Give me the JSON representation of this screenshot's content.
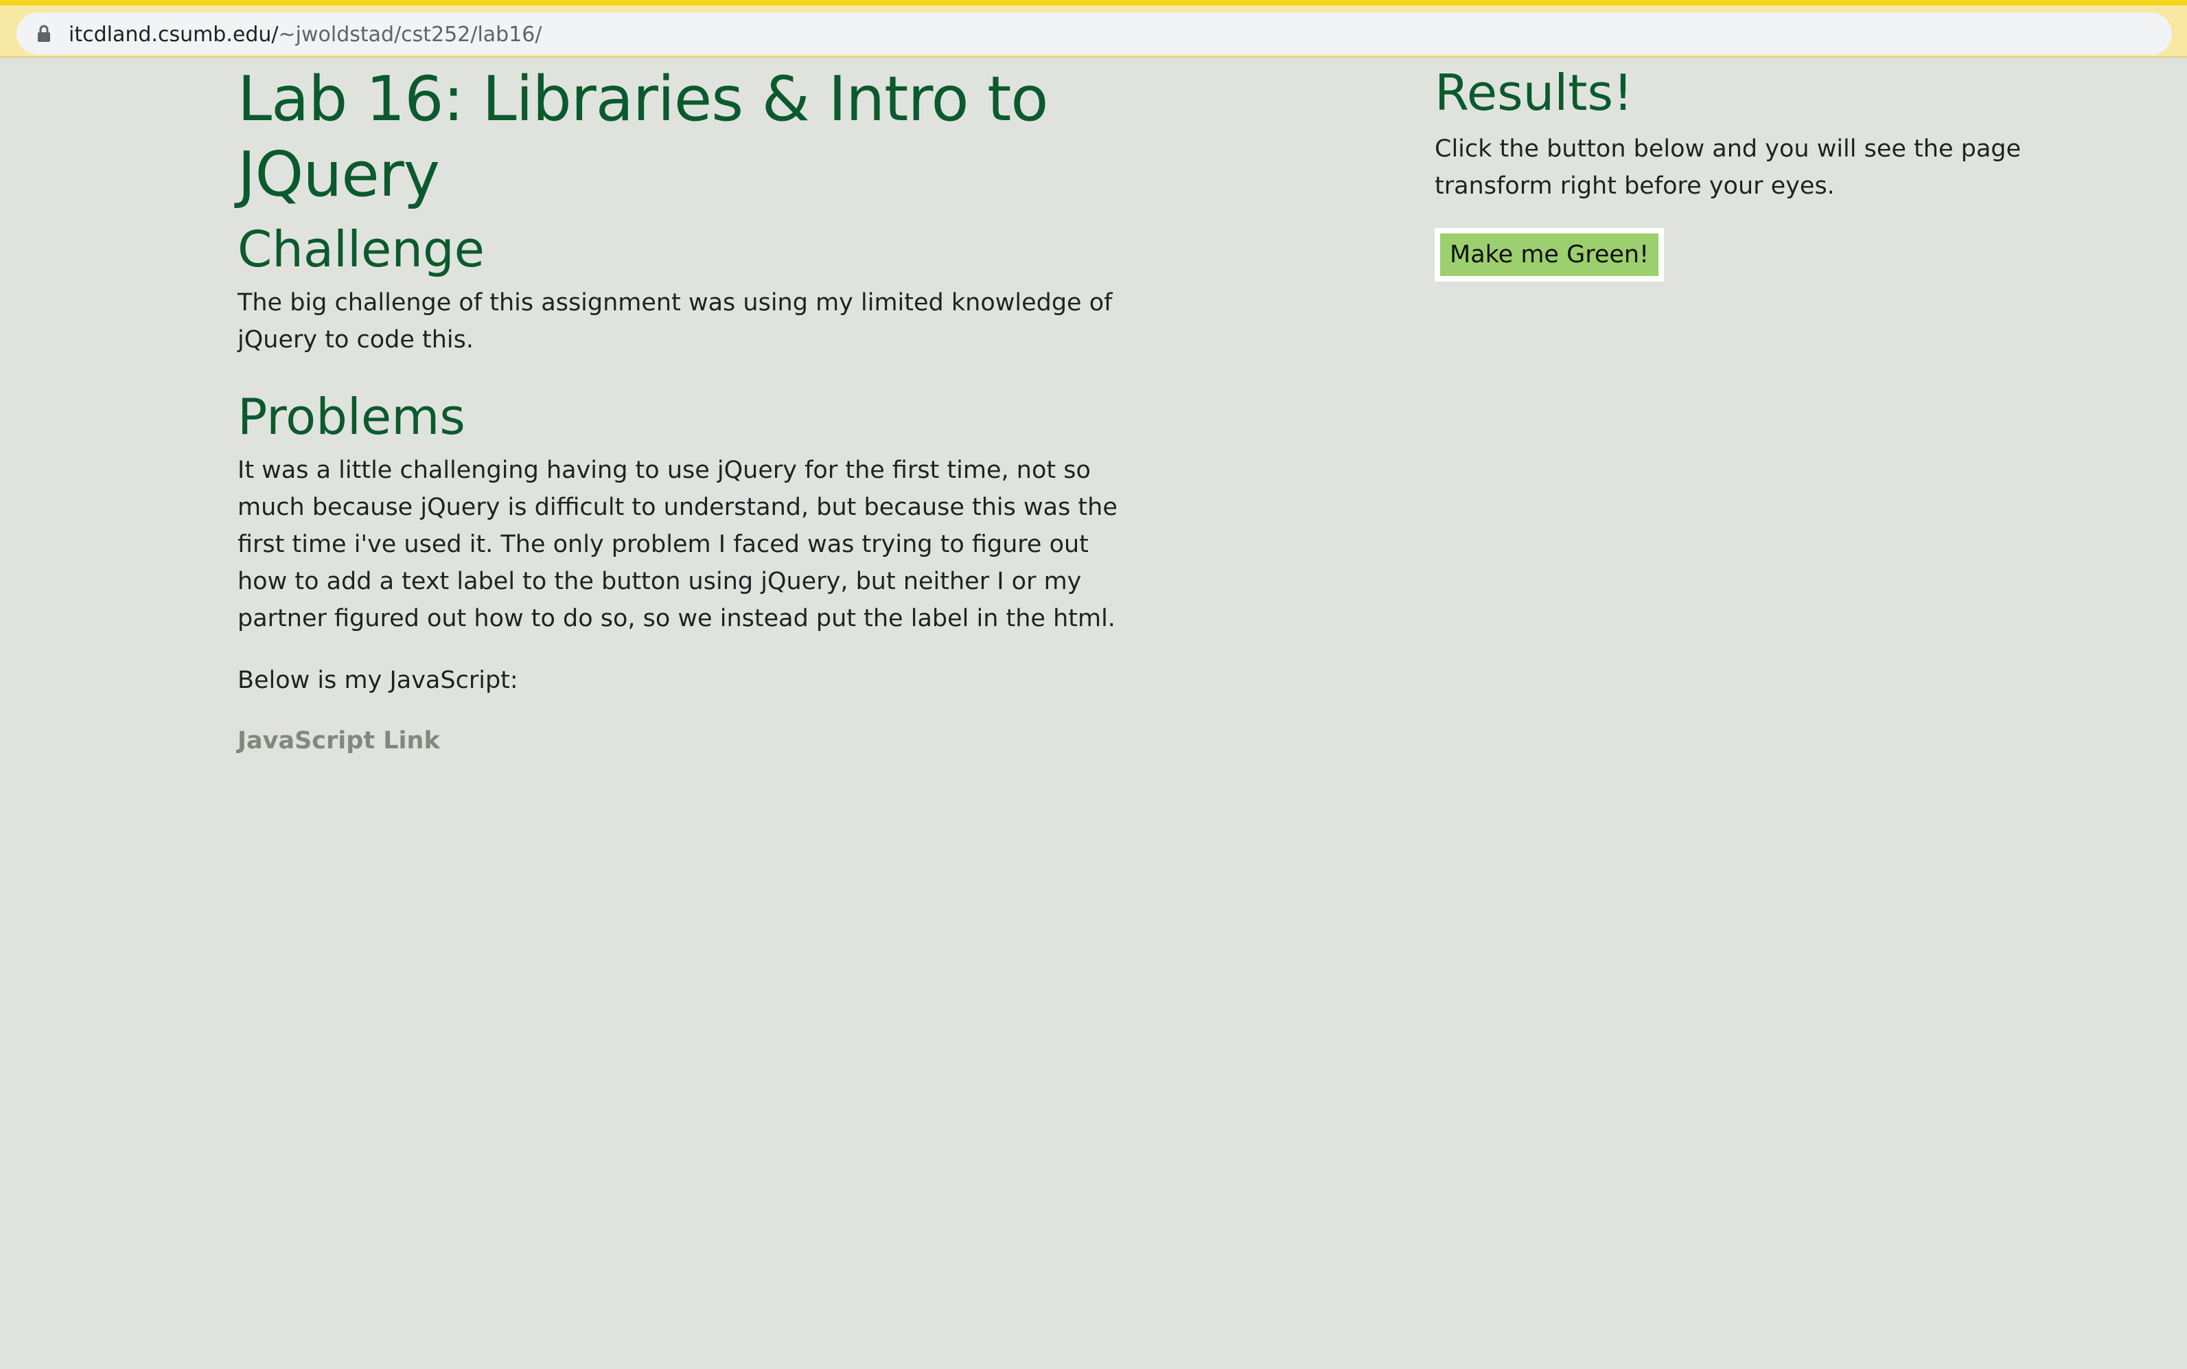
{
  "browser": {
    "url_host": "itcdland.csumb.edu/",
    "url_path": "~jwoldstad/cst252/lab16/",
    "lock_icon": "lock-icon"
  },
  "main": {
    "title": "Lab 16: Libraries & Intro to JQuery",
    "challenge_heading": "Challenge",
    "challenge_text": "The big challenge of this assignment was using my limited knowledge of jQuery to code this.",
    "problems_heading": "Problems",
    "problems_text": "It was a little challenging having to use jQuery for the first time, not so much because jQuery is difficult to understand, but because this was the first time i've used it. The only problem I faced was trying to figure out how to add a text label to the button using jQuery, but neither I or my partner figured out how to do so, so we instead put the label in the html.",
    "below_text": "Below is my JavaScript:",
    "js_link_label": "JavaScript Link"
  },
  "results": {
    "heading": "Results!",
    "text": "Click the button below and you will see the page transform right before your eyes.",
    "button_label": "Make me Green!"
  },
  "colors": {
    "page_background": "#e0e3dd",
    "heading_green": "#0b5a2e",
    "button_green": "#9ccf6e",
    "link_gray": "#7f8a7f"
  }
}
